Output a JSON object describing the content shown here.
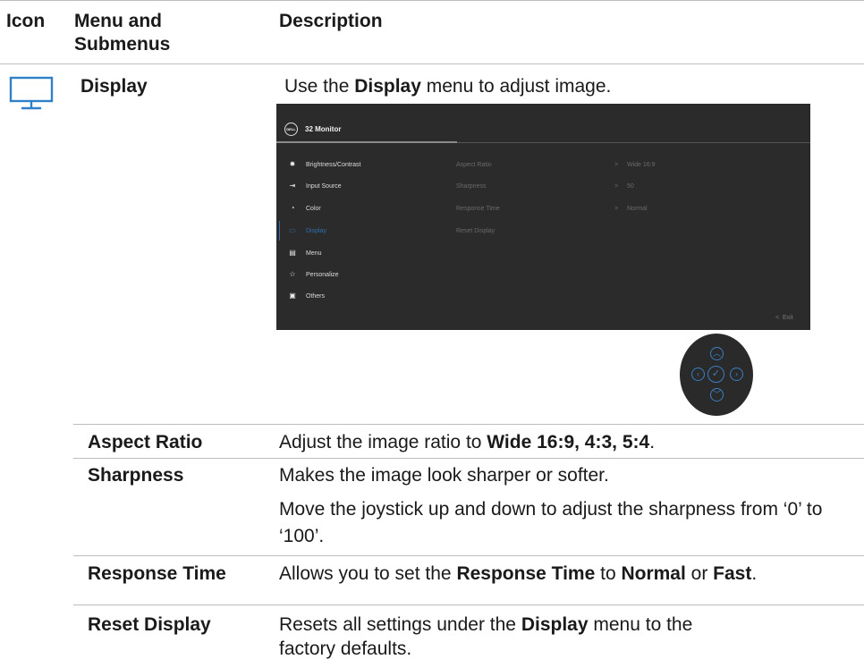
{
  "header": {
    "icon_col": "Icon",
    "menu_col_line1": "Menu and",
    "menu_col_line2": "Submenus",
    "desc_col": "Description"
  },
  "display_row": {
    "icon": "monitor-icon",
    "label": "Display",
    "desc_pre": "Use the ",
    "desc_bold": "Display",
    "desc_post": " menu to adjust image."
  },
  "osd": {
    "logo": "DELL",
    "title": "32 Monitor",
    "menu": [
      {
        "icon": "brightness-icon",
        "glyph": "✹",
        "label": "Brightness/Contrast"
      },
      {
        "icon": "input-source-icon",
        "glyph": "⇥",
        "label": "Input Source"
      },
      {
        "icon": "color-icon",
        "glyph": "◔",
        "label": "Color"
      },
      {
        "icon": "display-icon",
        "glyph": "▭",
        "label": "Display"
      },
      {
        "icon": "menu-icon",
        "glyph": "▤",
        "label": "Menu"
      },
      {
        "icon": "star-icon",
        "glyph": "☆",
        "label": "Personalize"
      },
      {
        "icon": "others-icon",
        "glyph": "▣",
        "label": "Others"
      }
    ],
    "active_index": 3,
    "submenu": [
      {
        "label": "Aspect Ratio",
        "value": "Wide 16:9"
      },
      {
        "label": "Sharpness",
        "value": "50"
      },
      {
        "label": "Response Time",
        "value": "Normal"
      },
      {
        "label": "Reset Display",
        "value": ""
      }
    ],
    "exit": "Exit",
    "colors": {
      "background": "#2b2b2b",
      "accent": "#2f6fb0"
    }
  },
  "joystick": {
    "up": "up-arrow-icon",
    "down": "down-arrow-icon",
    "left": "left-arrow-icon",
    "right": "right-arrow-icon",
    "center": "check-icon"
  },
  "rows": {
    "aspect": {
      "label": "Aspect Ratio",
      "pre": "Adjust the image ratio to ",
      "bold": "Wide 16:9, 4:3, 5:4",
      "post": "."
    },
    "sharpness": {
      "label": "Sharpness",
      "line1": "Makes the image look sharper or softer.",
      "line2": "Move the joystick up and down to adjust the sharpness from ‘0’ to ‘100’."
    },
    "response": {
      "label": "Response Time",
      "pre": "Allows you to set the ",
      "b1": "Response Time",
      "mid1": " to ",
      "b2": "Normal",
      "mid2": " or ",
      "b3": "Fast",
      "post": "."
    },
    "reset": {
      "label": "Reset Display",
      "pre": "Resets all settings under the ",
      "bold": "Display",
      "post": " menu to the factory defaults."
    }
  }
}
